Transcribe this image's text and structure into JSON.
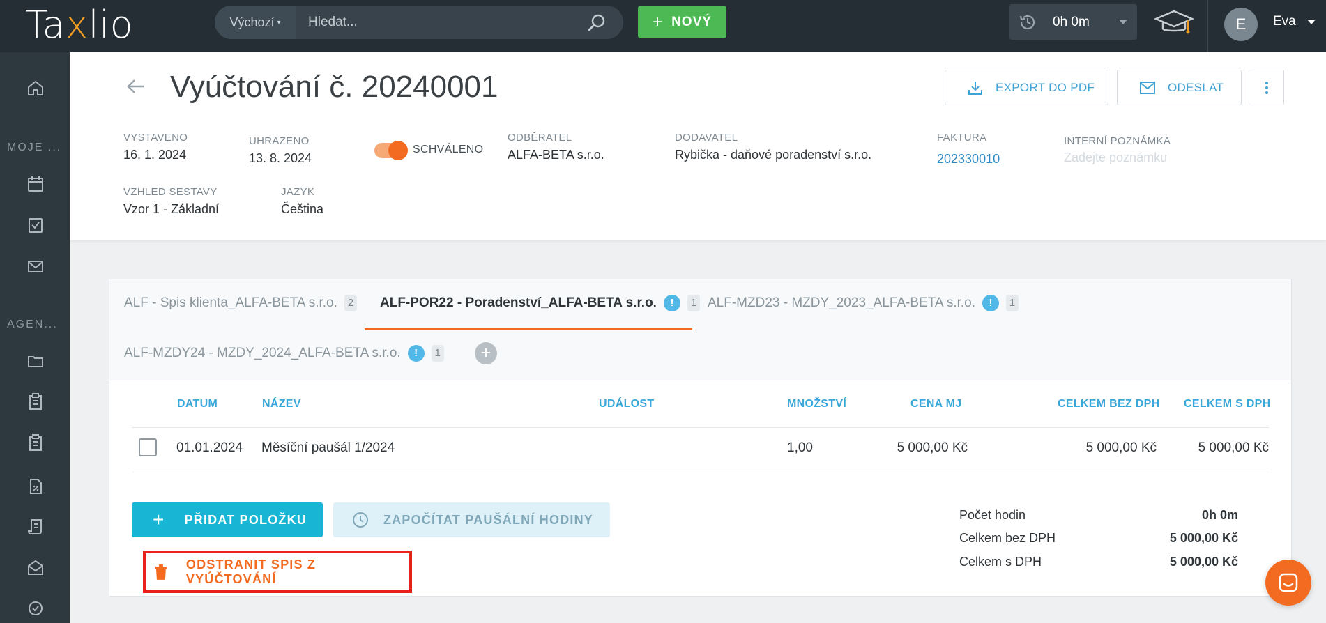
{
  "app": {
    "logo_pre": "Ta",
    "logo_x": "x",
    "logo_post": "lio"
  },
  "search": {
    "scope": "Výchozí",
    "placeholder": "Hledat..."
  },
  "topbar": {
    "new_label": "NOVÝ",
    "timer": "0h 0m",
    "user_initial": "E",
    "user_name": "Eva"
  },
  "sidebar": {
    "labels": [
      "MOJE ...",
      "AGEN..."
    ]
  },
  "header": {
    "title": "Vyúčtování č. 20240001",
    "export_label": "EXPORT DO PDF",
    "send_label": "ODESLAT",
    "meta": {
      "issued_label": "VYSTAVENO",
      "issued": "16. 1. 2024",
      "paid_label": "UHRAZENO",
      "paid": "13. 8. 2024",
      "approved_label": "SCHVÁLENO",
      "customer_label": "ODBĚRATEL",
      "customer": "ALFA-BETA s.r.o.",
      "supplier_label": "DODAVATEL",
      "supplier": "Rybička - daňové poradenství s.r.o.",
      "invoice_label": "FAKTURA",
      "invoice": "202330010",
      "note_label": "INTERNÍ POZNÁMKA",
      "note_placeholder": "Zadejte poznámku",
      "layout_label": "VZHLED SESTAVY",
      "layout": "Vzor 1 - Základní",
      "language_label": "JAZYK",
      "language": "Čeština"
    }
  },
  "tabs": [
    {
      "label": "ALF - Spis klienta_ALFA-BETA s.r.o.",
      "count": "2",
      "info": false,
      "active": false
    },
    {
      "label": "ALF-POR22 - Poradenství_ALFA-BETA s.r.o.",
      "count": "1",
      "info": true,
      "active": true
    },
    {
      "label": "ALF-MZD23 - MZDY_2023_ALFA-BETA s.r.o.",
      "count": "1",
      "info": true,
      "active": false
    },
    {
      "label": "ALF-MZDY24 - MZDY_2024_ALFA-BETA s.r.o.",
      "count": "1",
      "info": true,
      "active": false
    }
  ],
  "info_mark": "!",
  "tab_add": "+",
  "table": {
    "headers": {
      "date": "DATUM",
      "name": "NÁZEV",
      "event": "UDÁLOST",
      "qty": "MNOŽSTVÍ",
      "unit_price": "CENA MJ",
      "total_ex": "CELKEM BEZ DPH",
      "total_inc": "CELKEM S DPH"
    },
    "rows": [
      {
        "date": "01.01.2024",
        "name": "Měsíční paušál 1/2024",
        "event": "",
        "qty": "1,00",
        "unit_price": "5 000,00 Kč",
        "total_ex": "5 000,00 Kč",
        "total_inc": "5 000,00 Kč"
      }
    ]
  },
  "actions": {
    "add_item": "PŘIDAT POLOŽKU",
    "add_plus": "+",
    "count_hours": "ZAPOČÍTAT PAUŠÁLNÍ HODINY",
    "remove": "ODSTRANIT SPIS Z VYÚČTOVÁNÍ"
  },
  "summary": [
    {
      "label": "Počet hodin",
      "value": "0h 0m"
    },
    {
      "label": "Celkem bez DPH",
      "value": "5 000,00 Kč"
    },
    {
      "label": "Celkem s DPH",
      "value": "5 000,00 Kč"
    }
  ],
  "colors": {
    "accent": "#f36b21",
    "primary": "#18b5d4",
    "new": "#4cb955",
    "topbar": "#252e34",
    "sidebar": "#2e383f",
    "highlight": "#e8211b"
  }
}
